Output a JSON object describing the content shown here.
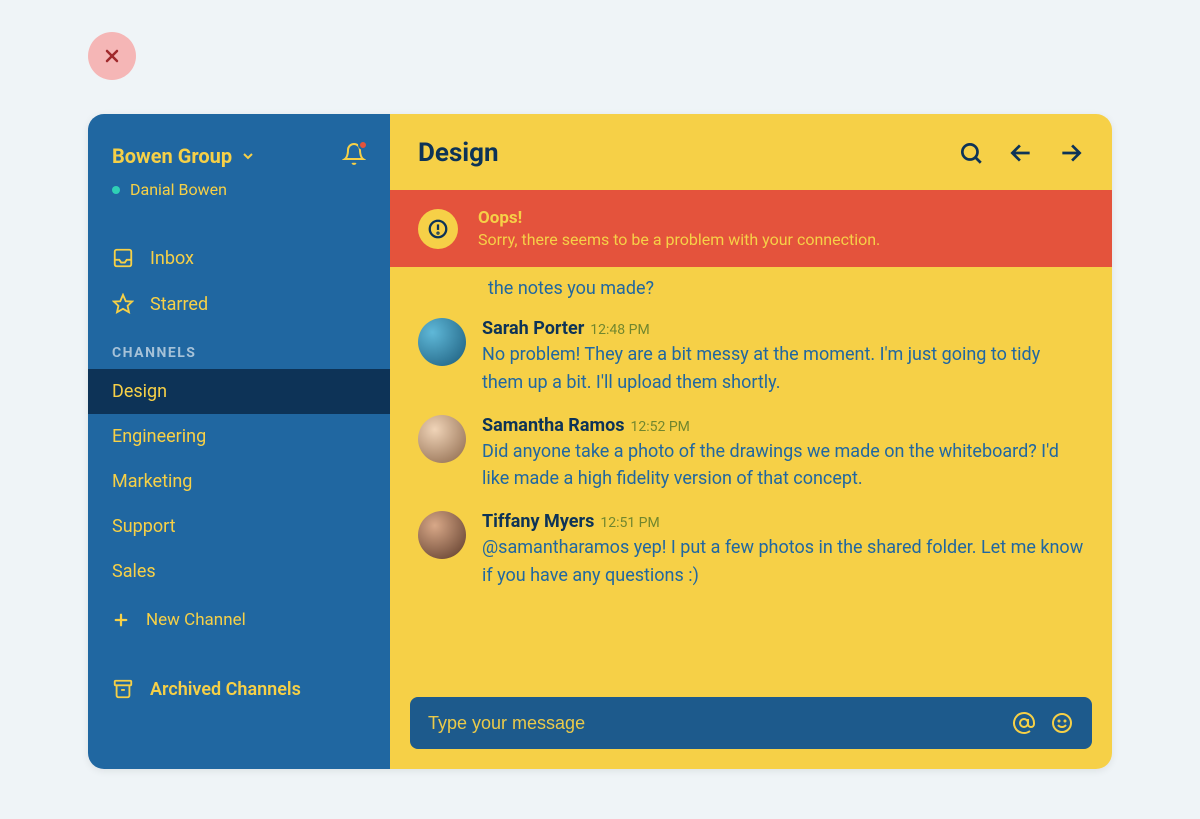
{
  "sidebar": {
    "workspace": "Bowen Group",
    "user": "Danial Bowen",
    "nav": {
      "inbox": "Inbox",
      "starred": "Starred"
    },
    "channels_label": "CHANNELS",
    "channels": [
      {
        "name": "Design",
        "active": true
      },
      {
        "name": "Engineering",
        "active": false
      },
      {
        "name": "Marketing",
        "active": false
      },
      {
        "name": "Support",
        "active": false
      },
      {
        "name": "Sales",
        "active": false
      }
    ],
    "new_channel": "New Channel",
    "archived": "Archived Channels"
  },
  "header": {
    "title": "Design"
  },
  "alert": {
    "title": "Oops!",
    "message": "Sorry, there seems to be a problem with your connection."
  },
  "partial_message": "the notes you made?",
  "messages": [
    {
      "author": "Sarah Porter",
      "time": "12:48 PM",
      "text": "No problem! They are a bit messy at the moment. I'm just going to tidy them up a bit. I'll upload them shortly."
    },
    {
      "author": "Samantha Ramos",
      "time": "12:52 PM",
      "text": "Did anyone take a photo of the drawings we made on the whiteboard? I'd like made a high fidelity version of that concept."
    },
    {
      "author": "Tiffany Myers",
      "time": "12:51 PM",
      "text": "@samantharamos yep! I put a few photos in the shared folder. Let me know if you have any questions :)"
    }
  ],
  "composer": {
    "placeholder": "Type your message"
  }
}
